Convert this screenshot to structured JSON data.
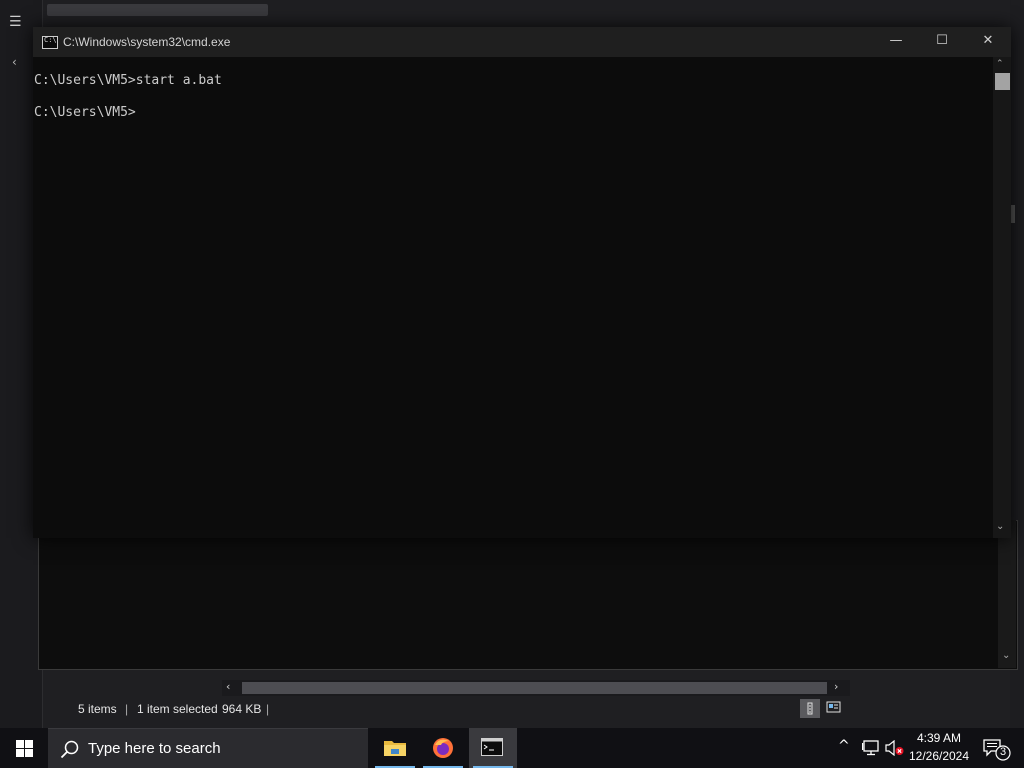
{
  "explorer": {
    "status_items": "5 items",
    "status_selected": "1 item selected",
    "status_size": "964 KB"
  },
  "cmd": {
    "title": "C:\\Windows\\system32\\cmd.exe",
    "icon_text": "C:\\",
    "minimize": "—",
    "maximize": "☐",
    "close": "✕",
    "lines": [
      "C:\\Users\\VM5>start a.bat",
      "",
      "C:\\Users\\VM5>"
    ]
  },
  "taskbar": {
    "search_placeholder": "Type here to search",
    "time": "4:39 AM",
    "date": "12/26/2024",
    "notification_count": "3",
    "tray_chevron": "^"
  },
  "icons": {
    "start": "windows-start-icon",
    "search": "search-icon",
    "explorer": "folder-icon",
    "firefox": "firefox-icon",
    "cmd": "terminal-icon",
    "network": "network-icon",
    "volume": "volume-muted-icon",
    "notifications": "notification-icon"
  },
  "colors": {
    "accent": "#76b9ed",
    "console_bg": "#0c0c0c",
    "console_text": "#cccccc",
    "taskbar_bg": "#101014"
  }
}
